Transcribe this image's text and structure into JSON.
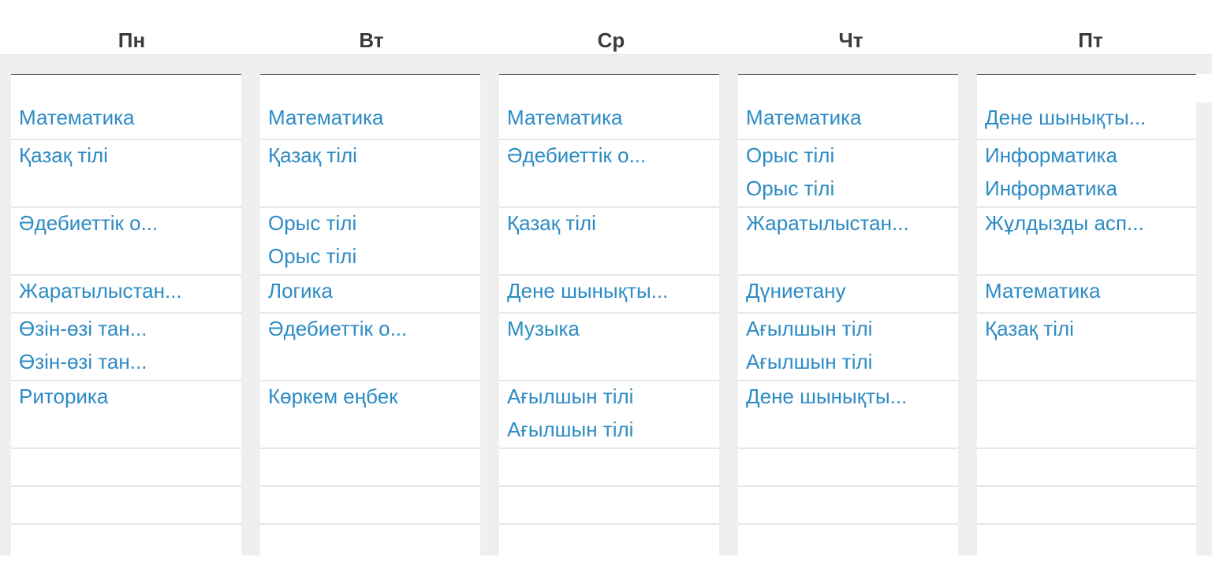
{
  "days": [
    {
      "label": "Пн",
      "slots": [
        [
          "Математика"
        ],
        [
          "Қазақ тілі"
        ],
        [
          "Әдебиеттік о..."
        ],
        [
          "Жаратылыстан..."
        ],
        [
          "Өзін-өзі тан...",
          "Өзін-өзі тан..."
        ],
        [
          "Риторика"
        ],
        [],
        [],
        []
      ]
    },
    {
      "label": "Вт",
      "slots": [
        [
          "Математика"
        ],
        [
          "Қазақ тілі"
        ],
        [
          "Орыс тілі",
          "Орыс тілі"
        ],
        [
          "Логика"
        ],
        [
          "Әдебиеттік о..."
        ],
        [
          "Көркем еңбек"
        ],
        [],
        [],
        []
      ]
    },
    {
      "label": "Ср",
      "slots": [
        [
          "Математика"
        ],
        [
          "Әдебиеттік о..."
        ],
        [
          "Қазақ тілі"
        ],
        [
          "Дене шынықты..."
        ],
        [
          "Музыка"
        ],
        [
          "Ағылшын тілі",
          "Ағылшын тілі"
        ],
        [],
        [],
        []
      ]
    },
    {
      "label": "Чт",
      "slots": [
        [
          "Математика"
        ],
        [
          "Орыс тілі",
          "Орыс тілі"
        ],
        [
          "Жаратылыстан..."
        ],
        [
          "Дүниетану"
        ],
        [
          "Ағылшын тілі",
          "Ағылшын тілі"
        ],
        [
          "Дене шынықты..."
        ],
        [],
        [],
        []
      ]
    },
    {
      "label": "Пт",
      "slots": [
        [
          "Дене шынықты..."
        ],
        [
          "Информатика",
          "Информатика"
        ],
        [
          "Жұлдызды асп..."
        ],
        [
          "Математика"
        ],
        [
          "Қазақ тілі"
        ],
        [],
        [],
        [],
        []
      ]
    }
  ],
  "colors": {
    "lesson_link": "#2d8bc4",
    "header_text": "#3b3b3b",
    "board_background": "#efefef",
    "slot_divider": "#e6e6e6"
  }
}
